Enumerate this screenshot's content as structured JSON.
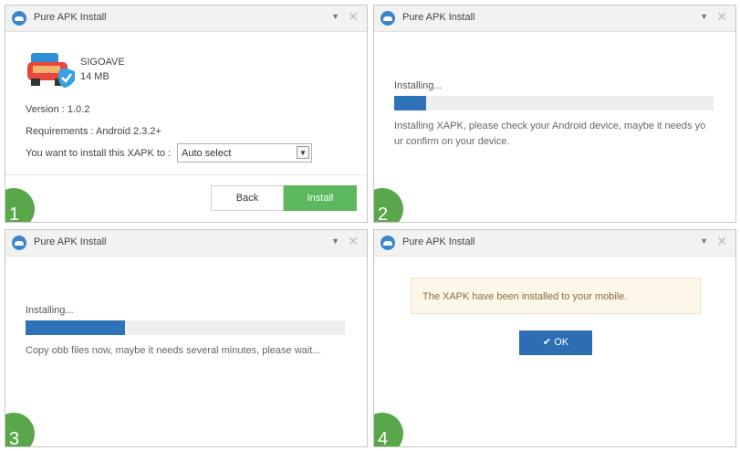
{
  "window_title": "Pure APK Install",
  "titlebar_icons": {
    "menu": "▼",
    "close": "✕"
  },
  "panel1": {
    "step": "1",
    "app_name": "SIGOAVE",
    "app_size": "14 MB",
    "version": "Version : 1.0.2",
    "requirements": "Requirements : Android 2.3.2+",
    "install_to_label": "You want to install this XAPK to :",
    "install_to_value": "Auto select",
    "back_label": "Back",
    "install_label": "Install"
  },
  "panel2": {
    "step": "2",
    "status": "Installing...",
    "progress": 0.1,
    "message_line1": "Installing XAPK, please check your Android device, maybe it needs yo",
    "message_line2": "ur confirm on your device."
  },
  "panel3": {
    "step": "3",
    "status": "Installing...",
    "progress": 0.31,
    "message": "Copy obb files now, maybe it needs several minutes, please wait..."
  },
  "panel4": {
    "step": "4",
    "message": "The XAPK have been installed to your mobile.",
    "ok_label": "OK"
  },
  "colors": {
    "accent_blue": "#2e72b8",
    "install_green": "#5cb85c",
    "step_badge_green": "#5aa64a",
    "alert_bg": "#fcf7e8"
  }
}
